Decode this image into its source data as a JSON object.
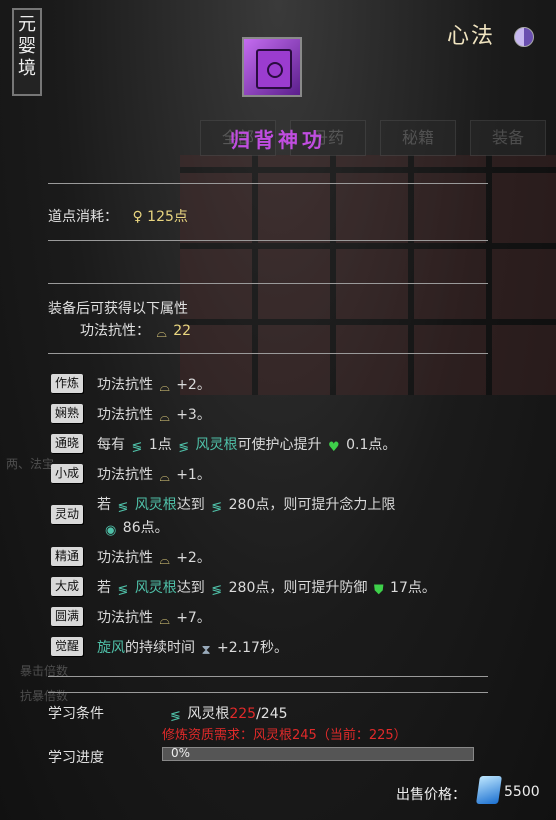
{
  "realm_label": "元婴境",
  "header_title": "心法",
  "item": {
    "name": "归背神功",
    "icon": "purple-book-icon"
  },
  "background_tabs": [
    "全部",
    "丹药",
    "秘籍",
    "装备"
  ],
  "cost": {
    "label": "道点消耗：",
    "value": "125点"
  },
  "equip": {
    "heading": "装备后可获得以下属性",
    "attr_label": "功法抗性：",
    "attr_value": "22"
  },
  "traits": [
    {
      "badge": "作炼",
      "text": "功法抗性",
      "suffix": "+2。",
      "color": "normal"
    },
    {
      "badge": "娴熟",
      "text": "功法抗性",
      "suffix": "+3。",
      "color": "green"
    },
    {
      "badge": "通晓",
      "pre": "每有",
      "n1": "1点",
      "root": "风灵根",
      "mid": "可使护心提升",
      "val": "0.1点。"
    },
    {
      "badge": "小成",
      "text": "功法抗性",
      "suffix": "+1。",
      "color": "normal"
    },
    {
      "badge": "灵动",
      "pre": "若",
      "root": "风灵根",
      "mid": "达到",
      "n1": "280点，则可提升念力上限",
      "val": "86点。"
    },
    {
      "badge": "精通",
      "text": "功法抗性",
      "suffix": "+2。",
      "color": "normal"
    },
    {
      "badge": "大成",
      "pre": "若",
      "root": "风灵根",
      "mid": "达到",
      "n1": "280点，则可提升防御",
      "val": "17点。"
    },
    {
      "badge": "圆满",
      "text": "功法抗性",
      "suffix": "+7。",
      "color": "purple"
    },
    {
      "badge": "觉醒",
      "root": "旋风",
      "mid": "的持续时间",
      "val": "+2.17秒。"
    }
  ],
  "learn": {
    "cond_label": "学习条件",
    "root_name": "风灵根",
    "current": "225",
    "required": "/245",
    "warning": "修炼资质需求：风灵根245（当前：225）",
    "progress_label": "学习进度",
    "progress_text": "0%",
    "progress_value": 0
  },
  "price": {
    "label": "出售价格：",
    "value": "5500"
  },
  "colors": {
    "title": "#c04de0",
    "green": "#3ed04a",
    "purple": "#c76ef0",
    "warning": "#e02a2a"
  }
}
